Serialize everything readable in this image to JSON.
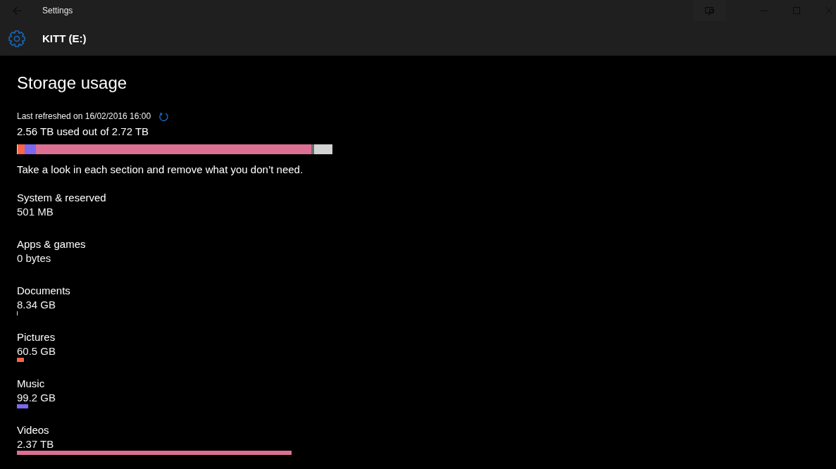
{
  "window": {
    "title": "Settings"
  },
  "header": {
    "title": "KITT (E:)"
  },
  "storage": {
    "heading": "Storage usage",
    "last_refreshed": "Last refreshed on 16/02/2016 16:00",
    "used_summary": "2.56 TB used out of 2.72 TB",
    "usage_bar": {
      "level": 0.941
    },
    "hint": "Take a look in each section and remove what you don’t need."
  },
  "categories": [
    {
      "name": "System & reserved",
      "size": "501 MB"
    },
    {
      "name": "Apps & games",
      "size": "0 bytes"
    },
    {
      "name": "Documents",
      "size": "8.34 GB",
      "level": 0.003,
      "color": "#f0e68c"
    },
    {
      "name": "Pictures",
      "size": "60.5 GB",
      "level": 0.022,
      "color": "#ff6347"
    },
    {
      "name": "Music",
      "size": "99.2 GB",
      "level": 0.036,
      "color": "#7b68ee"
    },
    {
      "name": "Videos",
      "size": "2.37 TB",
      "level": 0.871,
      "color": "#db7093"
    }
  ]
}
